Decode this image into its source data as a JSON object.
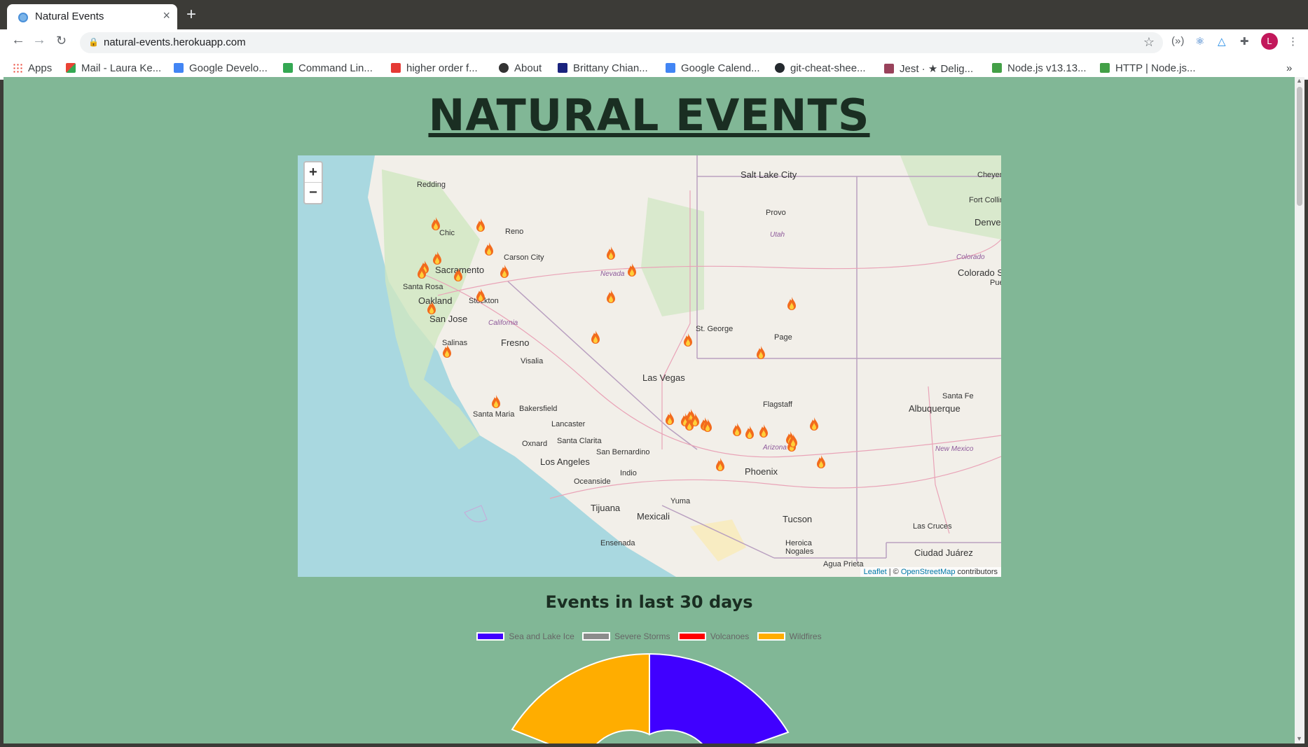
{
  "browser": {
    "tab_title": "Natural Events",
    "tab_close": "×",
    "new_tab": "+",
    "url": "natural-events.herokuapp.com",
    "avatar_letter": "L",
    "bookmarks": [
      {
        "label": "Apps",
        "color": "#ea4335"
      },
      {
        "label": "Mail - Laura Ke...",
        "color": "#f4b400"
      },
      {
        "label": "Google Develo...",
        "color": "#4285f4"
      },
      {
        "label": "Command Lin...",
        "color": "#34a853"
      },
      {
        "label": "higher order f...",
        "color": "#e53935"
      },
      {
        "label": "About",
        "color": "#333333"
      },
      {
        "label": "Brittany Chian...",
        "color": "#1a237e"
      },
      {
        "label": "Google Calend...",
        "color": "#4285f4"
      },
      {
        "label": "git-cheat-shee...",
        "color": "#24292e"
      },
      {
        "label": "Jest · ★ Delig...",
        "color": "#99425b"
      },
      {
        "label": "Node.js v13.13...",
        "color": "#43a047"
      },
      {
        "label": "HTTP | Node.js...",
        "color": "#43a047"
      }
    ],
    "more": "»"
  },
  "page": {
    "heading": "NATURAL EVENTS",
    "background": "#81b796"
  },
  "map": {
    "zoom_in": "+",
    "zoom_out": "−",
    "attribution_leaflet": "Leaflet",
    "attribution_sep": " | © ",
    "attribution_osm": "OpenStreetMap",
    "attribution_tail": " contributors",
    "cities": [
      {
        "name": "Salt Lake City",
        "big": true
      },
      {
        "name": "Redding"
      },
      {
        "name": "Provo"
      },
      {
        "name": "Fort Collin"
      },
      {
        "name": "Denver",
        "big": true
      },
      {
        "name": "Cheyen"
      },
      {
        "name": "Chic"
      },
      {
        "name": "Reno"
      },
      {
        "name": "Carson City"
      },
      {
        "name": "Sacramento",
        "big": true
      },
      {
        "name": "Santa Rosa"
      },
      {
        "name": "Oakland",
        "big": true
      },
      {
        "name": "Stockton"
      },
      {
        "name": "San Jose",
        "big": true
      },
      {
        "name": "Salinas"
      },
      {
        "name": "Fresno",
        "big": true
      },
      {
        "name": "Visalia"
      },
      {
        "name": "St. George"
      },
      {
        "name": "Page"
      },
      {
        "name": "Colorado S"
      },
      {
        "name": "Pue"
      },
      {
        "name": "Las Vegas",
        "big": true
      },
      {
        "name": "Santa Maria"
      },
      {
        "name": "Bakersfield"
      },
      {
        "name": "Lancaster"
      },
      {
        "name": "Flagstaff"
      },
      {
        "name": "Santa Fe"
      },
      {
        "name": "Albuquerque",
        "big": true
      },
      {
        "name": "Oxnard"
      },
      {
        "name": "Santa Clarita"
      },
      {
        "name": "San Bernardino"
      },
      {
        "name": "Los Angeles",
        "big": true
      },
      {
        "name": "Indio"
      },
      {
        "name": "Phoenix",
        "big": true
      },
      {
        "name": "Oceanside"
      },
      {
        "name": "Yuma"
      },
      {
        "name": "Tijuana",
        "big": true
      },
      {
        "name": "Mexicali",
        "big": true
      },
      {
        "name": "Tucson",
        "big": true
      },
      {
        "name": "Las Cruces"
      },
      {
        "name": "Ensenada"
      },
      {
        "name": "Heroica Nogales"
      },
      {
        "name": "Ciudad Juárez",
        "big": true
      },
      {
        "name": "Agua Prieta"
      }
    ],
    "states": [
      "Utah",
      "Nevada",
      "California",
      "Colorado",
      "Arizona",
      "New Mexico"
    ],
    "marker_icon": "fire-icon",
    "marker_count": 35
  },
  "chart": {
    "title": "Events in last 30 days"
  },
  "chart_data": {
    "type": "pie",
    "title": "Events in last 30 days",
    "legend_position": "top",
    "categories": [
      "Sea and Lake Ice",
      "Severe Storms",
      "Volcanoes",
      "Wildfires"
    ],
    "colors": [
      "#4000ff",
      "#8c8c8c",
      "#ff0000",
      "#ffad00"
    ],
    "visible_note": "only the top portion of the doughnut is visible; Sea and Lake Ice and Wildfires slices visible",
    "values": [
      null,
      null,
      null,
      null
    ]
  }
}
